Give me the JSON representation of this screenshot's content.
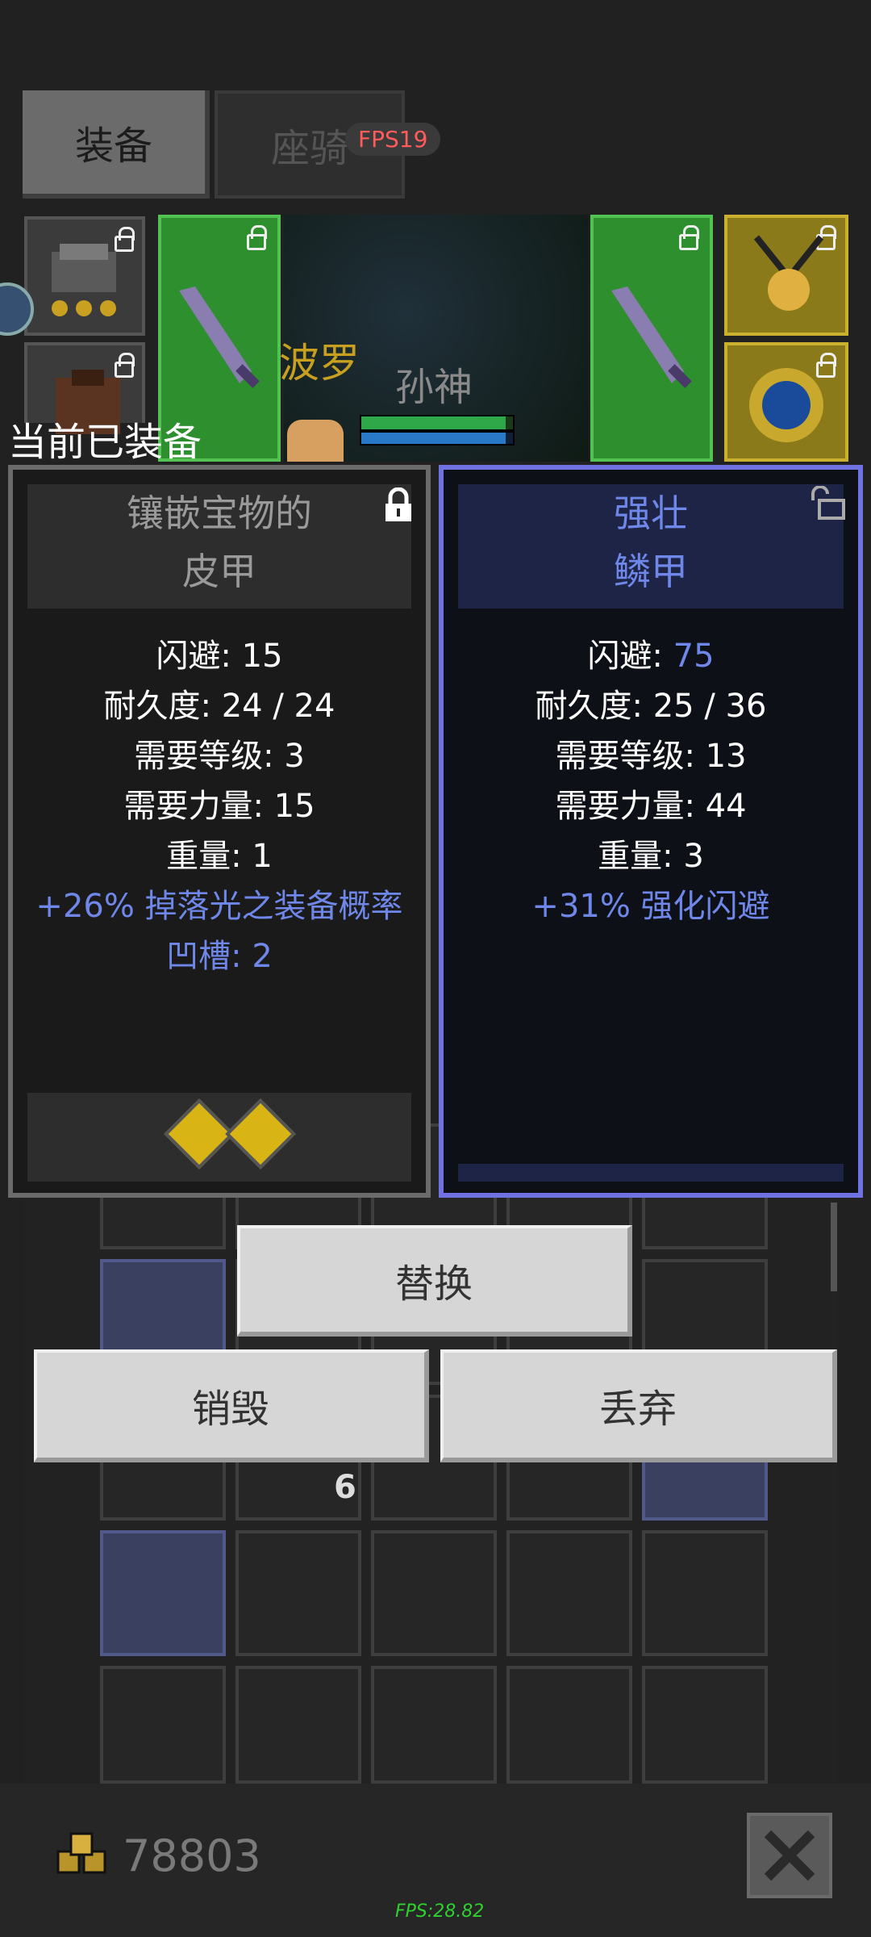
{
  "tabs": {
    "equip": "装备",
    "mount": "座骑"
  },
  "fps_top": "FPS19",
  "hero": {
    "pet_name": "波罗",
    "name": "孙神",
    "hp_fraction": 0.95,
    "mp_fraction": 0.95
  },
  "section_label": "当前已装备",
  "current_item": {
    "title_line1": "镶嵌宝物的",
    "title_line2": "皮甲",
    "evasion_label": "闪避: ",
    "evasion_value": "15",
    "durability": "耐久度: 24 / 24",
    "req_level": "需要等级: 3",
    "req_strength": "需要力量: 15",
    "weight": "重量: 1",
    "bonus": "+26% 掉落光之装备概率",
    "sockets": "凹槽: 2",
    "gem_count": 2
  },
  "new_item": {
    "title_line1": "强壮",
    "title_line2": "鳞甲",
    "evasion_label": "闪避: ",
    "evasion_value": "75",
    "durability": "耐久度: 25 / 36",
    "req_level": "需要等级: 13",
    "req_strength": "需要力量: 44",
    "weight": "重量: 3",
    "bonus": "+31% 强化闪避"
  },
  "buttons": {
    "replace": "替换",
    "destroy": "销毁",
    "discard": "丢弃"
  },
  "inventory": {
    "stack_count": "6"
  },
  "gold": "78803",
  "fps_bottom": "FPS:28.82",
  "colors": {
    "accent_blue": "#6f87e8",
    "green_slot": "#2d8f2d",
    "yellow_slot": "#8a7a1a"
  }
}
